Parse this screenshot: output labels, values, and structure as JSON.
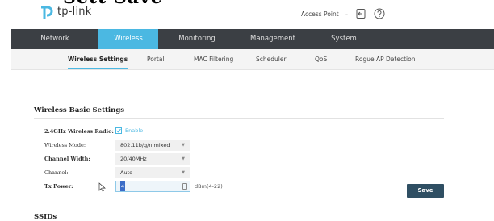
{
  "top_partial_text": "Sett Save",
  "header": {
    "logo_text": "tp-link",
    "mode_selector": "Access Point",
    "icons": [
      "logout-icon",
      "help-icon"
    ]
  },
  "nav": {
    "items": [
      {
        "label": "Network"
      },
      {
        "label": "Wireless",
        "active": true
      },
      {
        "label": "Monitoring"
      },
      {
        "label": "Management"
      },
      {
        "label": "System"
      }
    ]
  },
  "subnav": {
    "items": [
      {
        "label": "Wireless Settings",
        "active": true
      },
      {
        "label": "Portal"
      },
      {
        "label": "MAC Filtering"
      },
      {
        "label": "Scheduler"
      },
      {
        "label": "QoS"
      },
      {
        "label": "Rogue AP Detection"
      }
    ]
  },
  "basic": {
    "title": "Wireless Basic Settings",
    "radio_label": "2.4GHz Wireless Radio:",
    "radio_enable": "Enable",
    "mode_label": "Wireless Mode:",
    "mode_value": "802.11b/g/n mixed",
    "width_label": "Channel Width:",
    "width_value": "20/40MHz",
    "channel_label": "Channel:",
    "channel_value": "Auto",
    "tx_label": "Tx Power:",
    "tx_value": "4",
    "tx_unit": "dBm(4-22)",
    "save_label": "Save"
  },
  "ssids": {
    "title": "SSIDs"
  },
  "colors": {
    "accent": "#4bb8e2",
    "nav_bg": "#3b3f44",
    "save_bg": "#2f4f63",
    "logo": "#4bb8e2"
  }
}
